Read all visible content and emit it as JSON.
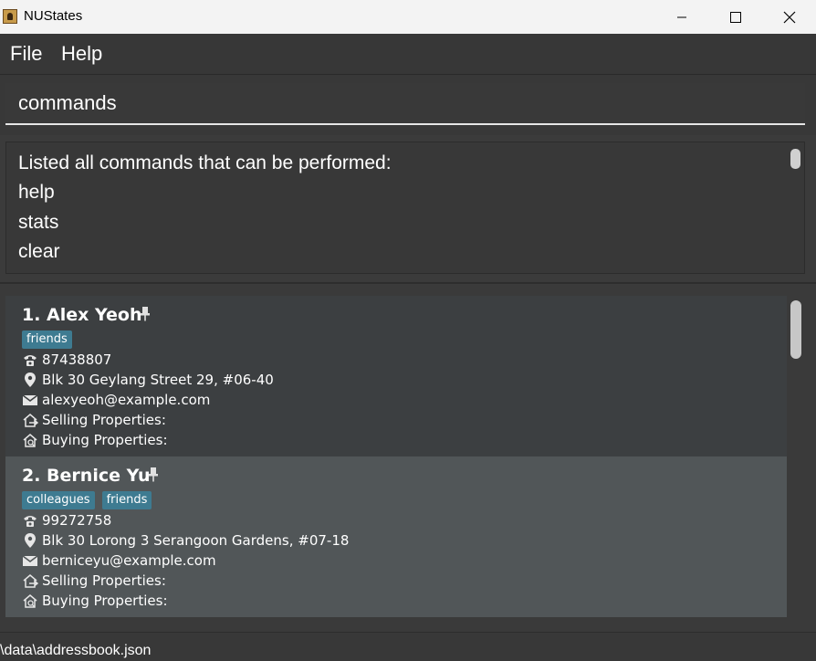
{
  "window": {
    "title": "NUStates"
  },
  "menu": {
    "items": [
      "File",
      "Help"
    ]
  },
  "command": {
    "value": "commands"
  },
  "result": {
    "lines": [
      "Listed all commands that can be performed:",
      "help",
      "stats",
      "clear"
    ]
  },
  "persons": [
    {
      "index_name": "1. Alex Yeoh",
      "tags": [
        "friends"
      ],
      "phone": "87438807",
      "address": "Blk 30 Geylang Street 29, #06-40",
      "email": "alexyeoh@example.com",
      "selling": "Selling Properties:",
      "buying": "Buying Properties:"
    },
    {
      "index_name": "2. Bernice Yu",
      "tags": [
        "colleagues",
        "friends"
      ],
      "phone": "99272758",
      "address": "Blk 30 Lorong 3 Serangoon Gardens, #07-18",
      "email": "berniceyu@example.com",
      "selling": "Selling Properties:",
      "buying": "Buying Properties:"
    }
  ],
  "status": {
    "path": "\\data\\addressbook.json"
  },
  "colors": {
    "tag": "#3e7b91",
    "card_selected": "#515658",
    "card": "#3c3f41",
    "background": "#3b3b3b"
  },
  "icons": [
    "app-icon",
    "pin-icon",
    "phone-icon",
    "location-icon",
    "mail-icon",
    "selling-house-icon",
    "buying-house-icon"
  ]
}
